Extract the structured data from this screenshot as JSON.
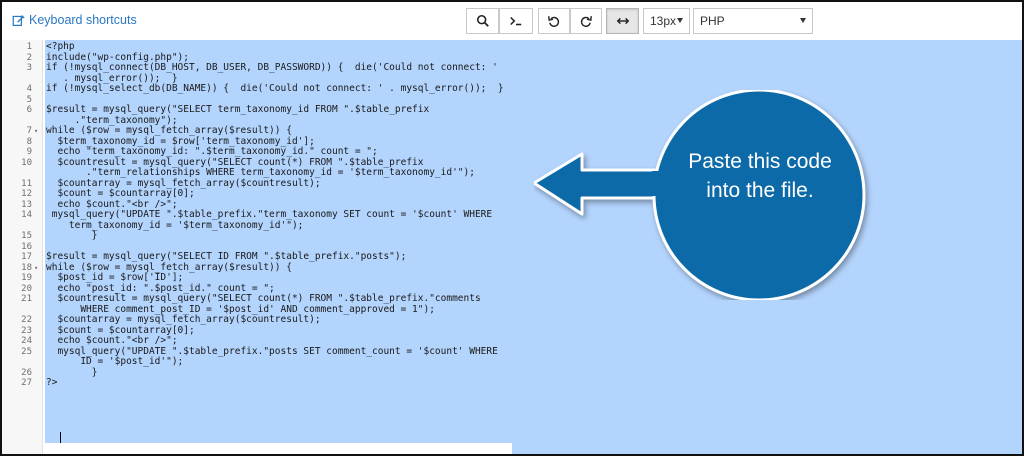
{
  "toolbar": {
    "keyboard_shortcuts_label": "Keyboard shortcuts",
    "font_size": "13px",
    "language": "PHP",
    "icons": [
      "search-icon",
      "terminal-icon",
      "undo-icon",
      "redo-icon",
      "wrap-toggle-icon"
    ]
  },
  "editor": {
    "lines": [
      {
        "n": "1",
        "code": "<?php"
      },
      {
        "n": "2",
        "code": "include(\"wp-config.php\");"
      },
      {
        "n": "3",
        "code": "if (!mysql_connect(DB_HOST, DB_USER, DB_PASSWORD)) {  die('Could not connect: '"
      },
      {
        "n": "",
        "code": "   . mysql_error());  }"
      },
      {
        "n": "4",
        "code": "if (!mysql_select_db(DB_NAME)) {  die('Could not connect: ' . mysql_error());  }"
      },
      {
        "n": "5",
        "code": ""
      },
      {
        "n": "6",
        "code": "$result = mysql_query(\"SELECT term_taxonomy_id FROM \".$table_prefix"
      },
      {
        "n": "",
        "code": "     .\"term_taxonomy\");"
      },
      {
        "n": "7",
        "code": "while ($row = mysql_fetch_array($result)) {",
        "fold": true
      },
      {
        "n": "8",
        "code": "  $term_taxonomy_id = $row['term_taxonomy_id'];"
      },
      {
        "n": "9",
        "code": "  echo \"term_taxonomy_id: \".$term_taxonomy_id.\" count = \";"
      },
      {
        "n": "10",
        "code": "  $countresult = mysql_query(\"SELECT count(*) FROM \".$table_prefix"
      },
      {
        "n": "",
        "code": "       .\"term_relationships WHERE term_taxonomy_id = '$term_taxonomy_id'\");"
      },
      {
        "n": "11",
        "code": "  $countarray = mysql_fetch_array($countresult);"
      },
      {
        "n": "12",
        "code": "  $count = $countarray[0];"
      },
      {
        "n": "13",
        "code": "  echo $count.\"<br />\";"
      },
      {
        "n": "14",
        "code": " mysql_query(\"UPDATE \".$table_prefix.\"term_taxonomy SET count = '$count' WHERE"
      },
      {
        "n": "",
        "code": "    term_taxonomy_id = '$term_taxonomy_id'\");"
      },
      {
        "n": "15",
        "code": "        }"
      },
      {
        "n": "16",
        "code": ""
      },
      {
        "n": "17",
        "code": "$result = mysql_query(\"SELECT ID FROM \".$table_prefix.\"posts\");"
      },
      {
        "n": "18",
        "code": "while ($row = mysql_fetch_array($result)) {",
        "fold": true
      },
      {
        "n": "19",
        "code": "  $post_id = $row['ID'];"
      },
      {
        "n": "20",
        "code": "  echo \"post_id: \".$post_id.\" count = \";"
      },
      {
        "n": "21",
        "code": "  $countresult = mysql_query(\"SELECT count(*) FROM \".$table_prefix.\"comments"
      },
      {
        "n": "",
        "code": "      WHERE comment_post_ID = '$post_id' AND comment_approved = 1\");"
      },
      {
        "n": "22",
        "code": "  $countarray = mysql_fetch_array($countresult);"
      },
      {
        "n": "23",
        "code": "  $count = $countarray[0];"
      },
      {
        "n": "24",
        "code": "  echo $count.\"<br />\";"
      },
      {
        "n": "25",
        "code": "  mysql_query(\"UPDATE \".$table_prefix.\"posts SET comment_count = '$count' WHERE"
      },
      {
        "n": "",
        "code": "      ID = '$post_id'\");"
      },
      {
        "n": "26",
        "code": "        }"
      },
      {
        "n": "27",
        "code": "?>"
      }
    ]
  },
  "callout": {
    "text_line1": "Paste this code",
    "text_line2": "into the file.",
    "color": "#0d6aa8"
  },
  "colors": {
    "selection": "#b3d4fd",
    "link": "#2a78c6"
  }
}
